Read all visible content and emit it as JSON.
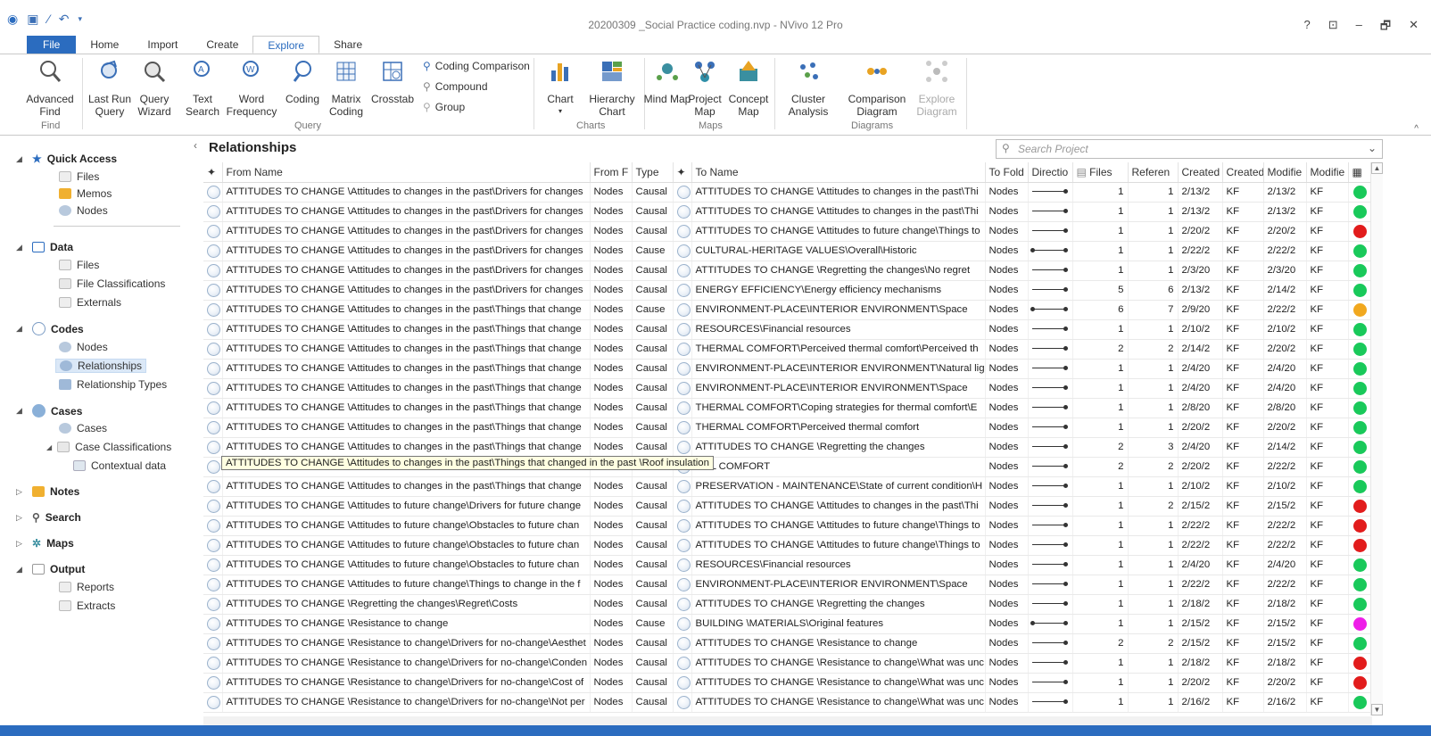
{
  "window": {
    "title": "20200309 _Social Practice coding.nvp - NVivo 12 Pro",
    "buttons": [
      "?",
      "⊡",
      "–",
      "🗗",
      "✕"
    ]
  },
  "menu_tabs": [
    "File",
    "Home",
    "Import",
    "Create",
    "Explore",
    "Share"
  ],
  "active_tab": "Explore",
  "ribbon": {
    "find": {
      "advanced_find": "Advanced Find",
      "group": "Find"
    },
    "query": {
      "last_run": "Last Run Query",
      "wizard": "Query Wizard",
      "text_search": "Text Search",
      "word_frequency": "Word Frequency",
      "coding": "Coding",
      "matrix_coding": "Matrix Coding",
      "crosstab": "Crosstab",
      "coding_comparison": "Coding Comparison",
      "compound": "Compound",
      "group_btn": "Group",
      "group": "Query"
    },
    "charts": {
      "chart": "Chart",
      "hierarchy": "Hierarchy Chart",
      "group": "Charts"
    },
    "maps": {
      "mind": "Mind Map",
      "project": "Project Map",
      "concept": "Concept Map",
      "group": "Maps"
    },
    "diagrams": {
      "cluster": "Cluster Analysis",
      "comparison": "Comparison Diagram",
      "explore": "Explore Diagram",
      "group": "Diagrams"
    }
  },
  "nav": {
    "quick_access": "Quick Access",
    "qa_items": [
      "Files",
      "Memos",
      "Nodes"
    ],
    "data": "Data",
    "data_items": [
      "Files",
      "File Classifications",
      "Externals"
    ],
    "codes": "Codes",
    "codes_items": [
      "Nodes",
      "Relationships",
      "Relationship Types"
    ],
    "cases": "Cases",
    "cases_items": [
      "Cases",
      "Case Classifications",
      "Contextual data"
    ],
    "notes": "Notes",
    "search": "Search",
    "maps": "Maps",
    "output": "Output",
    "output_items": [
      "Reports",
      "Extracts"
    ]
  },
  "list": {
    "title": "Relationships",
    "search_placeholder": "Search Project",
    "columns": [
      "From Name",
      "From F",
      "Type",
      "To Name",
      "To Fold",
      "Directio",
      "Files",
      "Referen",
      "Created",
      "Created",
      "Modifie",
      "Modifie"
    ],
    "tooltip": "ATTITUDES TO CHANGE \\Attitudes to changes in the past\\Things that changed in the past \\Roof insulation",
    "rows": [
      {
        "from": "ATTITUDES TO CHANGE \\Attitudes to changes in the past\\Drivers for changes",
        "ff": "Nodes",
        "type": "Causal",
        "to": "ATTITUDES TO CHANGE \\Attitudes to changes in the past\\Thi",
        "tf": "Nodes",
        "dir": "one",
        "files": "1",
        "refs": "1",
        "created": "2/13/2",
        "cby": "KF",
        "mod": "2/13/2",
        "mby": "KF",
        "color": "#19c95a"
      },
      {
        "from": "ATTITUDES TO CHANGE \\Attitudes to changes in the past\\Drivers for changes",
        "ff": "Nodes",
        "type": "Causal",
        "to": "ATTITUDES TO CHANGE \\Attitudes to changes in the past\\Thi",
        "tf": "Nodes",
        "dir": "one",
        "files": "1",
        "refs": "1",
        "created": "2/13/2",
        "cby": "KF",
        "mod": "2/13/2",
        "mby": "KF",
        "color": "#19c95a"
      },
      {
        "from": "ATTITUDES TO CHANGE \\Attitudes to changes in the past\\Drivers for changes",
        "ff": "Nodes",
        "type": "Causal",
        "to": "ATTITUDES TO CHANGE \\Attitudes to future change\\Things to",
        "tf": "Nodes",
        "dir": "one",
        "files": "1",
        "refs": "1",
        "created": "2/20/2",
        "cby": "KF",
        "mod": "2/20/2",
        "mby": "KF",
        "color": "#e21c1c"
      },
      {
        "from": "ATTITUDES TO CHANGE \\Attitudes to changes in the past\\Drivers for changes",
        "ff": "Nodes",
        "type": "Cause",
        "to": "CULTURAL-HERITAGE VALUES\\Overall\\Historic",
        "tf": "Nodes",
        "dir": "sym",
        "files": "1",
        "refs": "1",
        "created": "2/22/2",
        "cby": "KF",
        "mod": "2/22/2",
        "mby": "KF",
        "color": "#19c95a"
      },
      {
        "from": "ATTITUDES TO CHANGE \\Attitudes to changes in the past\\Drivers for changes",
        "ff": "Nodes",
        "type": "Causal",
        "to": "ATTITUDES TO CHANGE \\Regretting the changes\\No regret",
        "tf": "Nodes",
        "dir": "one",
        "files": "1",
        "refs": "1",
        "created": "2/3/20",
        "cby": "KF",
        "mod": "2/3/20",
        "mby": "KF",
        "color": "#19c95a"
      },
      {
        "from": "ATTITUDES TO CHANGE \\Attitudes to changes in the past\\Drivers for changes",
        "ff": "Nodes",
        "type": "Causal",
        "to": "ENERGY EFFICIENCY\\Energy efficiency mechanisms",
        "tf": "Nodes",
        "dir": "one",
        "files": "5",
        "refs": "6",
        "created": "2/13/2",
        "cby": "KF",
        "mod": "2/14/2",
        "mby": "KF",
        "color": "#19c95a"
      },
      {
        "from": "ATTITUDES TO CHANGE \\Attitudes to changes in the past\\Things that change",
        "ff": "Nodes",
        "type": "Cause",
        "to": "ENVIRONMENT-PLACE\\INTERIOR ENVIRONMENT\\Space",
        "tf": "Nodes",
        "dir": "sym",
        "files": "6",
        "refs": "7",
        "created": "2/9/20",
        "cby": "KF",
        "mod": "2/22/2",
        "mby": "KF",
        "color": "#f1a81f"
      },
      {
        "from": "ATTITUDES TO CHANGE \\Attitudes to changes in the past\\Things that change",
        "ff": "Nodes",
        "type": "Causal",
        "to": "RESOURCES\\Financial resources",
        "tf": "Nodes",
        "dir": "one",
        "files": "1",
        "refs": "1",
        "created": "2/10/2",
        "cby": "KF",
        "mod": "2/10/2",
        "mby": "KF",
        "color": "#19c95a"
      },
      {
        "from": "ATTITUDES TO CHANGE \\Attitudes to changes in the past\\Things that change",
        "ff": "Nodes",
        "type": "Causal",
        "to": "THERMAL COMFORT\\Perceived thermal comfort\\Perceived th",
        "tf": "Nodes",
        "dir": "one",
        "files": "2",
        "refs": "2",
        "created": "2/14/2",
        "cby": "KF",
        "mod": "2/20/2",
        "mby": "KF",
        "color": "#19c95a"
      },
      {
        "from": "ATTITUDES TO CHANGE \\Attitudes to changes in the past\\Things that change",
        "ff": "Nodes",
        "type": "Causal",
        "to": "ENVIRONMENT-PLACE\\INTERIOR ENVIRONMENT\\Natural lig",
        "tf": "Nodes",
        "dir": "one",
        "files": "1",
        "refs": "1",
        "created": "2/4/20",
        "cby": "KF",
        "mod": "2/4/20",
        "mby": "KF",
        "color": "#19c95a"
      },
      {
        "from": "ATTITUDES TO CHANGE \\Attitudes to changes in the past\\Things that change",
        "ff": "Nodes",
        "type": "Causal",
        "to": "ENVIRONMENT-PLACE\\INTERIOR ENVIRONMENT\\Space",
        "tf": "Nodes",
        "dir": "one",
        "files": "1",
        "refs": "1",
        "created": "2/4/20",
        "cby": "KF",
        "mod": "2/4/20",
        "mby": "KF",
        "color": "#19c95a"
      },
      {
        "from": "ATTITUDES TO CHANGE \\Attitudes to changes in the past\\Things that change",
        "ff": "Nodes",
        "type": "Causal",
        "to": "THERMAL COMFORT\\Coping strategies for thermal comfort\\E",
        "tf": "Nodes",
        "dir": "one",
        "files": "1",
        "refs": "1",
        "created": "2/8/20",
        "cby": "KF",
        "mod": "2/8/20",
        "mby": "KF",
        "color": "#19c95a"
      },
      {
        "from": "ATTITUDES TO CHANGE \\Attitudes to changes in the past\\Things that change",
        "ff": "Nodes",
        "type": "Causal",
        "to": "THERMAL COMFORT\\Perceived thermal comfort",
        "tf": "Nodes",
        "dir": "one",
        "files": "1",
        "refs": "1",
        "created": "2/20/2",
        "cby": "KF",
        "mod": "2/20/2",
        "mby": "KF",
        "color": "#19c95a"
      },
      {
        "from": "ATTITUDES TO CHANGE \\Attitudes to changes in the past\\Things that change",
        "ff": "Nodes",
        "type": "Causal",
        "to": "ATTITUDES TO CHANGE \\Regretting the changes",
        "tf": "Nodes",
        "dir": "one",
        "files": "2",
        "refs": "3",
        "created": "2/4/20",
        "cby": "KF",
        "mod": "2/14/2",
        "mby": "KF",
        "color": "#19c95a"
      },
      {
        "from": "",
        "ff": "",
        "type": "",
        "to": "MAL COMFORT",
        "tf": "Nodes",
        "dir": "one",
        "files": "2",
        "refs": "2",
        "created": "2/20/2",
        "cby": "KF",
        "mod": "2/22/2",
        "mby": "KF",
        "color": "#19c95a"
      },
      {
        "from": "ATTITUDES TO CHANGE \\Attitudes to changes in the past\\Things that change",
        "ff": "Nodes",
        "type": "Causal",
        "to": "PRESERVATION - MAINTENANCE\\State of current condition\\H",
        "tf": "Nodes",
        "dir": "one",
        "files": "1",
        "refs": "1",
        "created": "2/10/2",
        "cby": "KF",
        "mod": "2/10/2",
        "mby": "KF",
        "color": "#19c95a"
      },
      {
        "from": "ATTITUDES TO CHANGE \\Attitudes to future change\\Drivers for future change",
        "ff": "Nodes",
        "type": "Causal",
        "to": "ATTITUDES TO CHANGE \\Attitudes to changes in the past\\Thi",
        "tf": "Nodes",
        "dir": "one",
        "files": "1",
        "refs": "2",
        "created": "2/15/2",
        "cby": "KF",
        "mod": "2/15/2",
        "mby": "KF",
        "color": "#e21c1c"
      },
      {
        "from": "ATTITUDES TO CHANGE \\Attitudes to future change\\Obstacles to future chan",
        "ff": "Nodes",
        "type": "Causal",
        "to": "ATTITUDES TO CHANGE \\Attitudes to future change\\Things to",
        "tf": "Nodes",
        "dir": "one",
        "files": "1",
        "refs": "1",
        "created": "2/22/2",
        "cby": "KF",
        "mod": "2/22/2",
        "mby": "KF",
        "color": "#e21c1c"
      },
      {
        "from": "ATTITUDES TO CHANGE \\Attitudes to future change\\Obstacles to future chan",
        "ff": "Nodes",
        "type": "Causal",
        "to": "ATTITUDES TO CHANGE \\Attitudes to future change\\Things to",
        "tf": "Nodes",
        "dir": "one",
        "files": "1",
        "refs": "1",
        "created": "2/22/2",
        "cby": "KF",
        "mod": "2/22/2",
        "mby": "KF",
        "color": "#e21c1c"
      },
      {
        "from": "ATTITUDES TO CHANGE \\Attitudes to future change\\Obstacles to future chan",
        "ff": "Nodes",
        "type": "Causal",
        "to": "RESOURCES\\Financial resources",
        "tf": "Nodes",
        "dir": "one",
        "files": "1",
        "refs": "1",
        "created": "2/4/20",
        "cby": "KF",
        "mod": "2/4/20",
        "mby": "KF",
        "color": "#19c95a"
      },
      {
        "from": "ATTITUDES TO CHANGE \\Attitudes to future change\\Things to change in the f",
        "ff": "Nodes",
        "type": "Causal",
        "to": "ENVIRONMENT-PLACE\\INTERIOR ENVIRONMENT\\Space",
        "tf": "Nodes",
        "dir": "one",
        "files": "1",
        "refs": "1",
        "created": "2/22/2",
        "cby": "KF",
        "mod": "2/22/2",
        "mby": "KF",
        "color": "#19c95a"
      },
      {
        "from": "ATTITUDES TO CHANGE \\Regretting the changes\\Regret\\Costs",
        "ff": "Nodes",
        "type": "Causal",
        "to": "ATTITUDES TO CHANGE \\Regretting the changes",
        "tf": "Nodes",
        "dir": "one",
        "files": "1",
        "refs": "1",
        "created": "2/18/2",
        "cby": "KF",
        "mod": "2/18/2",
        "mby": "KF",
        "color": "#19c95a"
      },
      {
        "from": "ATTITUDES TO CHANGE \\Resistance to change",
        "ff": "Nodes",
        "type": "Cause",
        "to": "BUILDING \\MATERIALS\\Original features",
        "tf": "Nodes",
        "dir": "sym",
        "files": "1",
        "refs": "1",
        "created": "2/15/2",
        "cby": "KF",
        "mod": "2/15/2",
        "mby": "KF",
        "color": "#ee1ee8"
      },
      {
        "from": "ATTITUDES TO CHANGE \\Resistance to change\\Drivers for no-change\\Aesthet",
        "ff": "Nodes",
        "type": "Causal",
        "to": "ATTITUDES TO CHANGE \\Resistance to change",
        "tf": "Nodes",
        "dir": "one",
        "files": "2",
        "refs": "2",
        "created": "2/15/2",
        "cby": "KF",
        "mod": "2/15/2",
        "mby": "KF",
        "color": "#19c95a"
      },
      {
        "from": "ATTITUDES TO CHANGE \\Resistance to change\\Drivers for no-change\\Conden",
        "ff": "Nodes",
        "type": "Causal",
        "to": "ATTITUDES TO CHANGE \\Resistance to change\\What was unc",
        "tf": "Nodes",
        "dir": "one",
        "files": "1",
        "refs": "1",
        "created": "2/18/2",
        "cby": "KF",
        "mod": "2/18/2",
        "mby": "KF",
        "color": "#e21c1c"
      },
      {
        "from": "ATTITUDES TO CHANGE \\Resistance to change\\Drivers for no-change\\Cost of",
        "ff": "Nodes",
        "type": "Causal",
        "to": "ATTITUDES TO CHANGE \\Resistance to change\\What was unc",
        "tf": "Nodes",
        "dir": "one",
        "files": "1",
        "refs": "1",
        "created": "2/20/2",
        "cby": "KF",
        "mod": "2/20/2",
        "mby": "KF",
        "color": "#e21c1c"
      },
      {
        "from": "ATTITUDES TO CHANGE \\Resistance to change\\Drivers for no-change\\Not per",
        "ff": "Nodes",
        "type": "Causal",
        "to": "ATTITUDES TO CHANGE \\Resistance to change\\What was unc",
        "tf": "Nodes",
        "dir": "one",
        "files": "1",
        "refs": "1",
        "created": "2/16/2",
        "cby": "KF",
        "mod": "2/16/2",
        "mby": "KF",
        "color": "#19c95a"
      }
    ]
  }
}
